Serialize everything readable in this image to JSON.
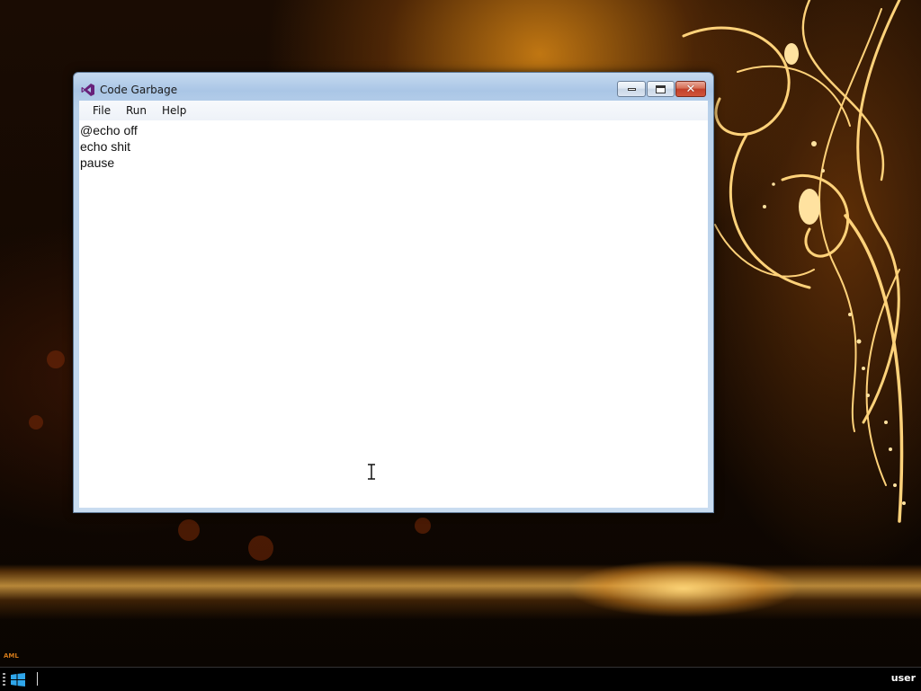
{
  "window": {
    "title": "Code Garbage",
    "icon": "visual-studio-icon",
    "buttons": {
      "minimize": "minimize-icon",
      "maximize": "maximize-icon",
      "close": "close-icon"
    }
  },
  "menu": {
    "file": "File",
    "run": "Run",
    "help": "Help"
  },
  "editor": {
    "lines": [
      "@echo off",
      "echo shit",
      "pause"
    ]
  },
  "desktop": {
    "watermark": "AML"
  },
  "taskbar": {
    "start_icon": "windows-logo-icon",
    "user": "user"
  },
  "colors": {
    "accent_icon": "#68217a",
    "close_button": "#c2402a",
    "titlebar": "#aac6e6"
  }
}
